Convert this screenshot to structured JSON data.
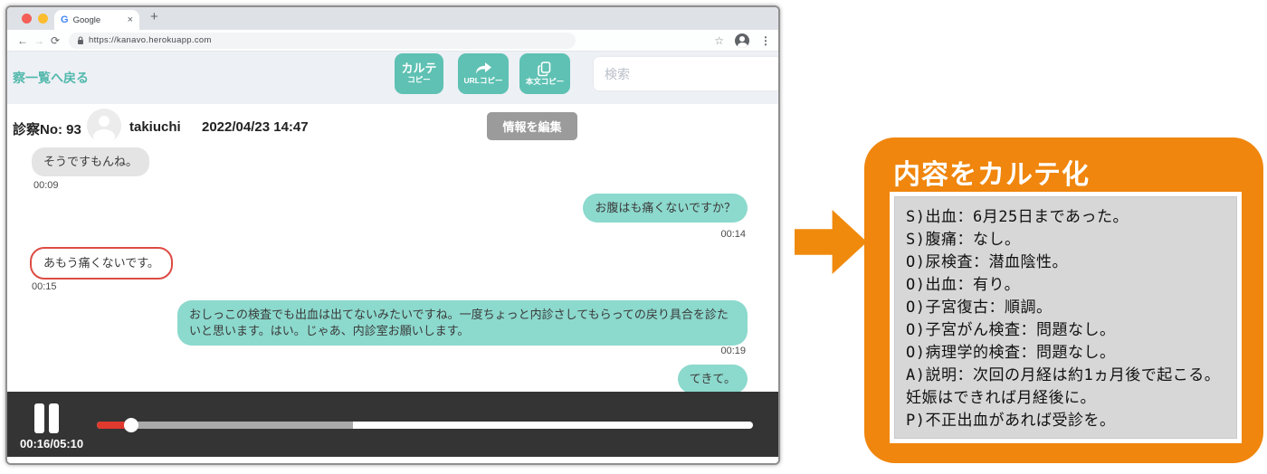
{
  "browser": {
    "tab_title": "Google",
    "url": "https://kanavo.herokuapp.com"
  },
  "header": {
    "back_link": "察一覧へ戻る",
    "buttons": {
      "karte_copy": {
        "line1": "カルテ",
        "line2": "コピー"
      },
      "url_copy": {
        "label": "URLコピー"
      },
      "body_copy": {
        "label": "本文コピー"
      }
    },
    "search_placeholder": "検索"
  },
  "consult": {
    "number_label": "診察No: 93",
    "user_name": "takiuchi",
    "datetime": "2022/04/23 14:47",
    "edit_button": "情報を編集"
  },
  "chat": {
    "messages": [
      {
        "side": "left",
        "variant": "gray",
        "text": "そうですもんね。",
        "time": "00:09"
      },
      {
        "side": "right",
        "variant": "teal",
        "text": "お腹はも痛くないですか？",
        "time": "00:14"
      },
      {
        "side": "left",
        "variant": "red-outline",
        "text": "あもう痛くないです。",
        "time": "00:15"
      },
      {
        "side": "right",
        "variant": "teal",
        "text": "おしっこの検査でも出血は出てないみたいですね。一度ちょっと内診さしてもらっての戻り具合を診たいと思います。はい。じゃあ、内診室お願いします。",
        "time": "00:19"
      },
      {
        "side": "right",
        "variant": "teal",
        "text": "てきて。",
        "time": ""
      }
    ]
  },
  "player": {
    "time_display": "00:16/05:10",
    "played_pct": 5.2,
    "buffered_pct": 39
  },
  "callout": {
    "title": "内容をカルテ化",
    "lines": [
      "S)出血：6月25日まであった。",
      "S)腹痛：なし。",
      "O)尿検査：潜血陰性。",
      "O)出血：有り。",
      "O)子宮復古：順調。",
      "O)子宮がん検査：問題なし。",
      "O)病理学的検査：問題なし。",
      "A)説明：次回の月経は約1ヵ月後で起こる。妊娠はできれば月経後に。",
      "P)不正出血があれば受診を。"
    ]
  },
  "colors": {
    "teal_button": "#5ec1b3",
    "teal_bubble": "#8cd9cd",
    "teal_link": "#53b8ac",
    "orange": "#f0860d",
    "player_red": "#e0392e",
    "red_outline": "#dd4b43",
    "gray_bubble": "#e4e4e4"
  }
}
